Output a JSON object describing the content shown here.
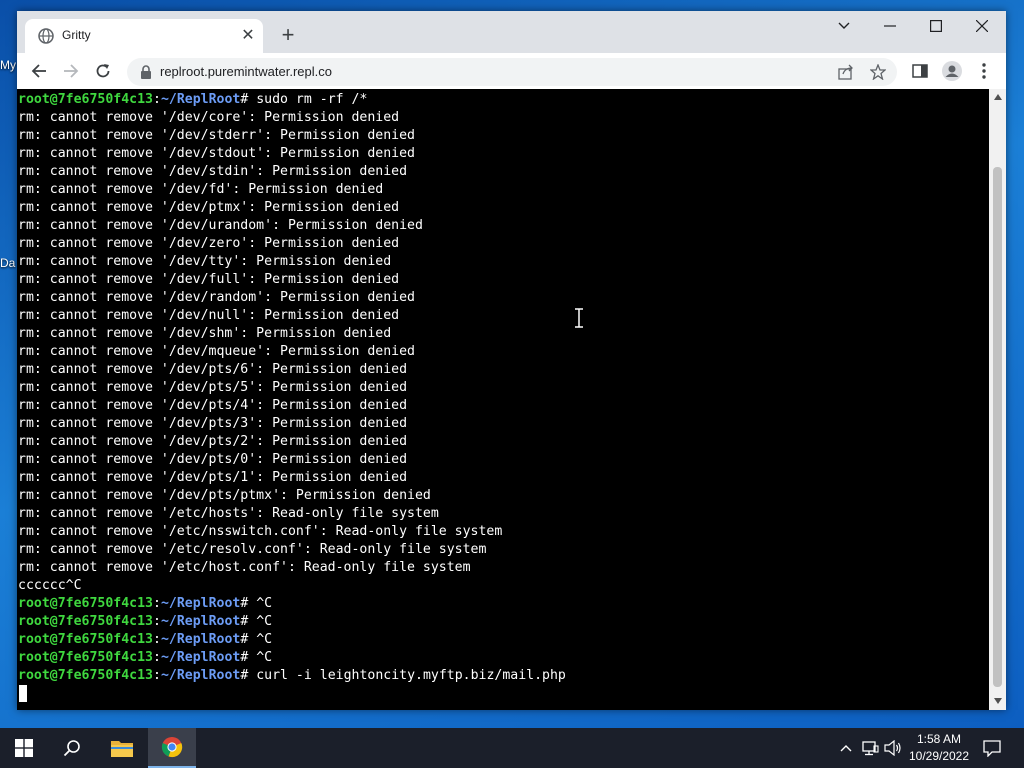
{
  "desktop": {
    "icon_label_1": "My",
    "icon_label_2": "Da"
  },
  "browser": {
    "tab_title": "Gritty",
    "url": "replroot.puremintwater.repl.co"
  },
  "terminal": {
    "prompt_user": "root@7fe6750f4c13",
    "prompt_path": "~/ReplRoot",
    "lines": [
      {
        "kind": "cmd",
        "text": "sudo rm -rf /*"
      },
      {
        "kind": "out",
        "text": "rm: cannot remove '/dev/core': Permission denied"
      },
      {
        "kind": "out",
        "text": "rm: cannot remove '/dev/stderr': Permission denied"
      },
      {
        "kind": "out",
        "text": "rm: cannot remove '/dev/stdout': Permission denied"
      },
      {
        "kind": "out",
        "text": "rm: cannot remove '/dev/stdin': Permission denied"
      },
      {
        "kind": "out",
        "text": "rm: cannot remove '/dev/fd': Permission denied"
      },
      {
        "kind": "out",
        "text": "rm: cannot remove '/dev/ptmx': Permission denied"
      },
      {
        "kind": "out",
        "text": "rm: cannot remove '/dev/urandom': Permission denied"
      },
      {
        "kind": "out",
        "text": "rm: cannot remove '/dev/zero': Permission denied"
      },
      {
        "kind": "out",
        "text": "rm: cannot remove '/dev/tty': Permission denied"
      },
      {
        "kind": "out",
        "text": "rm: cannot remove '/dev/full': Permission denied"
      },
      {
        "kind": "out",
        "text": "rm: cannot remove '/dev/random': Permission denied"
      },
      {
        "kind": "out",
        "text": "rm: cannot remove '/dev/null': Permission denied"
      },
      {
        "kind": "out",
        "text": "rm: cannot remove '/dev/shm': Permission denied"
      },
      {
        "kind": "out",
        "text": "rm: cannot remove '/dev/mqueue': Permission denied"
      },
      {
        "kind": "out",
        "text": "rm: cannot remove '/dev/pts/6': Permission denied"
      },
      {
        "kind": "out",
        "text": "rm: cannot remove '/dev/pts/5': Permission denied"
      },
      {
        "kind": "out",
        "text": "rm: cannot remove '/dev/pts/4': Permission denied"
      },
      {
        "kind": "out",
        "text": "rm: cannot remove '/dev/pts/3': Permission denied"
      },
      {
        "kind": "out",
        "text": "rm: cannot remove '/dev/pts/2': Permission denied"
      },
      {
        "kind": "out",
        "text": "rm: cannot remove '/dev/pts/0': Permission denied"
      },
      {
        "kind": "out",
        "text": "rm: cannot remove '/dev/pts/1': Permission denied"
      },
      {
        "kind": "out",
        "text": "rm: cannot remove '/dev/pts/ptmx': Permission denied"
      },
      {
        "kind": "out",
        "text": "rm: cannot remove '/etc/hosts': Read-only file system"
      },
      {
        "kind": "out",
        "text": "rm: cannot remove '/etc/nsswitch.conf': Read-only file system"
      },
      {
        "kind": "out",
        "text": "rm: cannot remove '/etc/resolv.conf': Read-only file system"
      },
      {
        "kind": "out",
        "text": "rm: cannot remove '/etc/host.conf': Read-only file system"
      },
      {
        "kind": "out",
        "text": "cccccc^C"
      },
      {
        "kind": "cmd",
        "text": "^C"
      },
      {
        "kind": "cmd",
        "text": "^C"
      },
      {
        "kind": "cmd",
        "text": "^C"
      },
      {
        "kind": "cmd",
        "text": "^C"
      },
      {
        "kind": "cmd",
        "text": "curl -i leightoncity.myftp.biz/mail.php"
      }
    ]
  },
  "taskbar": {
    "time": "1:58 AM",
    "date": "10/29/2022"
  },
  "colors": {
    "prompt_user": "#3fd83f",
    "prompt_path": "#6c9cf5",
    "terminal_bg": "#000000",
    "terminal_fg": "#ffffff"
  }
}
